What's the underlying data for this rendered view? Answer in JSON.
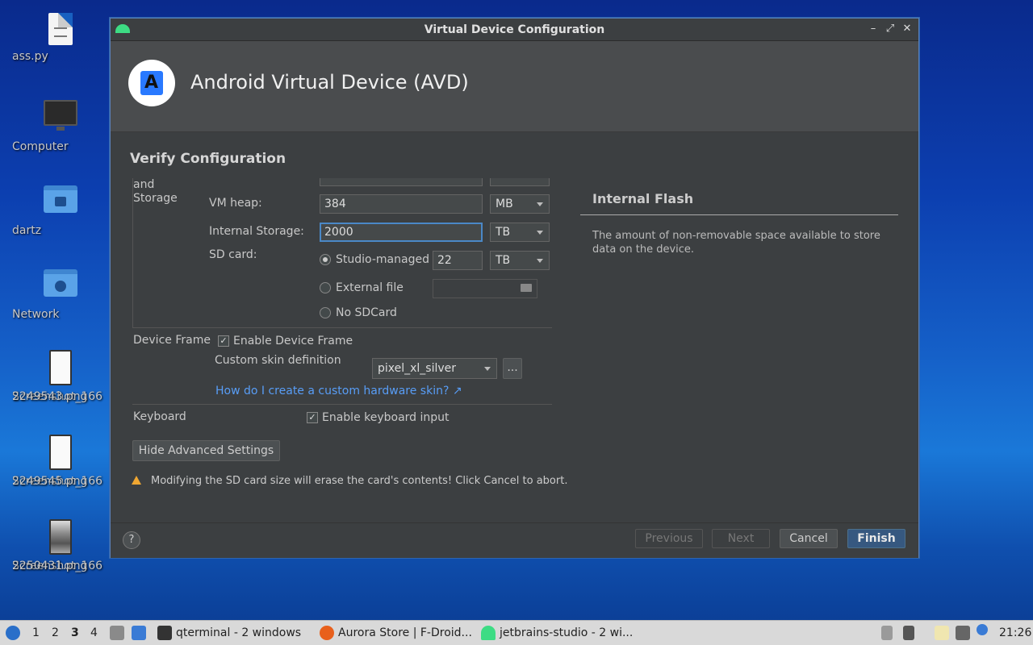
{
  "desktop": {
    "icons": [
      {
        "label": "ass.py"
      },
      {
        "label": "Computer"
      },
      {
        "label": "dartz"
      },
      {
        "label": "Network"
      },
      {
        "label": "Screenshot_166\n2249543.png",
        "l1": "Screenshot_166",
        "l2": "2249543.png"
      },
      {
        "label": "Screenshot_1662249545.png",
        "l1": "Screenshot_166",
        "l2": "2249545.png"
      },
      {
        "label": "Screenshot_1662250431.png",
        "l1": "Screenshot_166",
        "l2": "2250431.png"
      }
    ]
  },
  "window": {
    "title": "Virtual Device Configuration",
    "controls": {
      "minimize": "–",
      "restore": "⤢",
      "close": "✕"
    },
    "header_title": "Android Virtual Device (AVD)",
    "section_title": "Verify Configuration",
    "memory": {
      "group_label_line1": "and",
      "group_label_line2": "Storage",
      "vm_heap_label": "VM heap:",
      "vm_heap_value": "384",
      "vm_heap_unit": "MB",
      "internal_storage_label": "Internal Storage:",
      "internal_storage_value": "2000",
      "internal_storage_unit": "TB",
      "sd_card_label": "SD card:",
      "studio_managed_label": "Studio-managed",
      "studio_managed_value": "22",
      "studio_managed_unit": "TB",
      "external_file_label": "External file",
      "no_sdcard_label": "No SDCard"
    },
    "device_frame": {
      "label": "Device Frame",
      "enable_label": "Enable Device Frame",
      "custom_skin_label": "Custom skin definition",
      "skin_value": "pixel_xl_silver",
      "browse_label": "...",
      "help_link": "How do I create a custom hardware skin? ↗"
    },
    "keyboard": {
      "label": "Keyboard",
      "enable_label": "Enable keyboard input"
    },
    "hide_advanced_label": "Hide Advanced Settings",
    "info": {
      "title": "Internal Flash",
      "text": "The amount of non-removable space available to store data on the device."
    },
    "warning": "Modifying the SD card size will erase the card's contents! Click Cancel to abort.",
    "footer": {
      "help": "?",
      "previous": "Previous",
      "next": "Next",
      "cancel": "Cancel",
      "finish": "Finish"
    }
  },
  "taskbar": {
    "workspaces": [
      "1",
      "2",
      "3",
      "4"
    ],
    "tasks": [
      {
        "label": "qterminal - 2 windows"
      },
      {
        "label": "Aurora Store | F-Droid..."
      },
      {
        "label": "jetbrains-studio - 2 wi..."
      }
    ],
    "clock": "21:26"
  },
  "colors": {
    "android_green": "#3ddc84",
    "link_blue": "#589df6",
    "primary_button": "#365880",
    "warning": "#f0a732"
  }
}
